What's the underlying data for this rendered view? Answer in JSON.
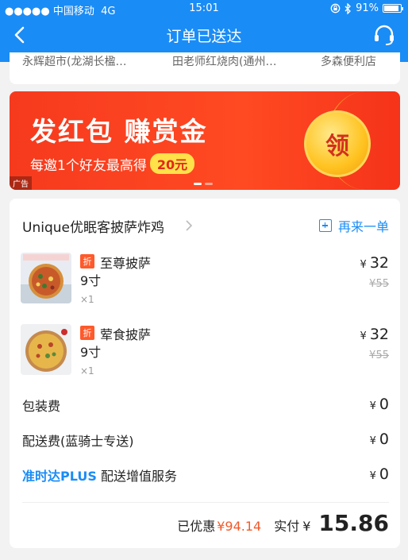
{
  "status_bar": {
    "carrier": "●●●●● 中国移动",
    "network": "4G",
    "time": "15:01",
    "battery": "91%"
  },
  "nav": {
    "title": "订单已送达"
  },
  "stores": [
    "永辉超市(龙湖长楹…",
    "田老师红烧肉(通州…",
    "多森便利店"
  ],
  "banner": {
    "headline": "发红包 赚赏金",
    "sub_prefix": "每邀1个好友最高得",
    "sub_amount": "20元",
    "coin": "领",
    "ad_label": "广告"
  },
  "order": {
    "store_name": "Unique优眠客披萨炸鸡",
    "reorder_label": "再来一单",
    "items": [
      {
        "discount_tag": "折",
        "name": "至尊披萨",
        "spec": "9寸",
        "qty": "×1",
        "currency": "¥",
        "price": "32",
        "original_price": "¥55"
      },
      {
        "discount_tag": "折",
        "name": "荤食披萨",
        "spec": "9寸",
        "qty": "×1",
        "currency": "¥",
        "price": "32",
        "original_price": "¥55"
      }
    ],
    "fees": [
      {
        "label": "包装费",
        "currency": "¥",
        "value": "0"
      },
      {
        "label": "配送费(蓝骑士专送)",
        "currency": "¥",
        "value": "0"
      },
      {
        "tag": "准时达PLUS",
        "label": "配送增值服务",
        "currency": "¥",
        "value": "0"
      }
    ],
    "saved_label": "已优惠",
    "saved_amount": "¥94.14",
    "paid_label": "实付",
    "paid_currency": "¥",
    "paid_amount": "15.86"
  },
  "colors": {
    "brand": "#1a8cf6",
    "banner": "#f63a1e",
    "discount": "#f15a2b"
  }
}
